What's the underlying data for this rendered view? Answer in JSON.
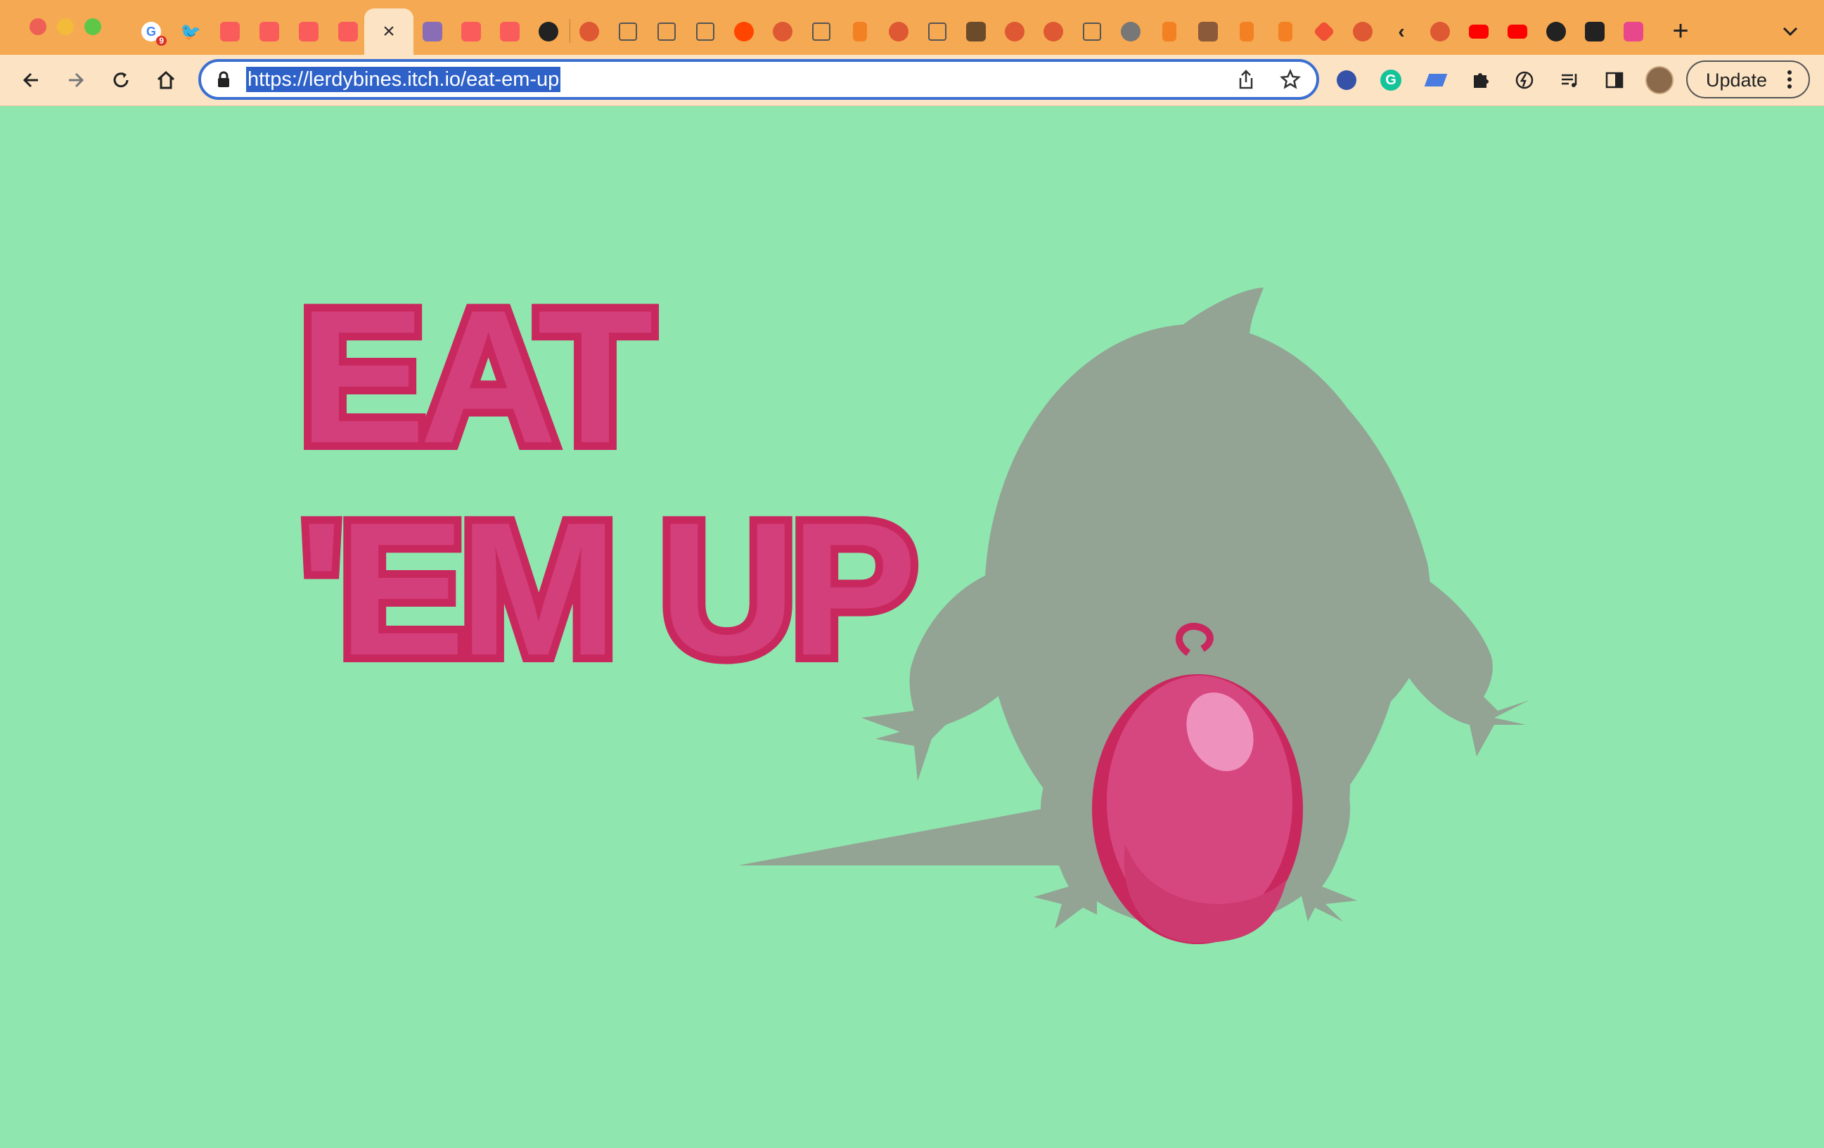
{
  "browser": {
    "active_tab_close": "×",
    "new_tab": "+",
    "url": "https://lerdybines.itch.io/eat-em-up",
    "tab_icons": [
      "google-tab-icon",
      "twitter-tab-icon",
      "itch-tab-icon",
      "itch-tab-icon",
      "itch-tab-icon",
      "itch-tab-icon",
      "game-tab-icon",
      "itch-tab-icon",
      "itch-tab-icon",
      "github-tab-icon",
      "duckduckgo-tab-icon",
      "unity-tab-icon",
      "unity-tab-icon",
      "unity-tab-icon",
      "reddit-tab-icon",
      "duckduckgo-tab-icon",
      "unity-tab-icon",
      "stackoverflow-tab-icon",
      "duckduckgo-tab-icon",
      "unity-tab-icon",
      "app-tab-icon",
      "duckduckgo-tab-icon",
      "duckduckgo-tab-icon",
      "unity-tab-icon",
      "globe-tab-icon",
      "stackoverflow-tab-icon",
      "blocks-tab-icon",
      "stackoverflow-tab-icon",
      "stackoverflow-tab-icon",
      "git-tab-icon",
      "duckduckgo-tab-icon",
      "code-tab-icon",
      "duckduckgo-tab-icon",
      "youtube-tab-icon",
      "youtube-tab-icon",
      "github-tab-icon",
      "itch-dev-tab-icon",
      "app-tab-icon"
    ],
    "google_badge": "9",
    "update_label": "Update",
    "colors": {
      "tabstrip": "#f5a952",
      "toolbar": "#fbe3c4",
      "page_bg": "#8fe6ae",
      "title_pink": "#d23a76",
      "title_outline": "#c9285f",
      "mole_gray": "#93a394",
      "egg_pink": "#d7477f"
    }
  },
  "page": {
    "title_line1": "EAT",
    "title_line2": "'EM UP"
  }
}
